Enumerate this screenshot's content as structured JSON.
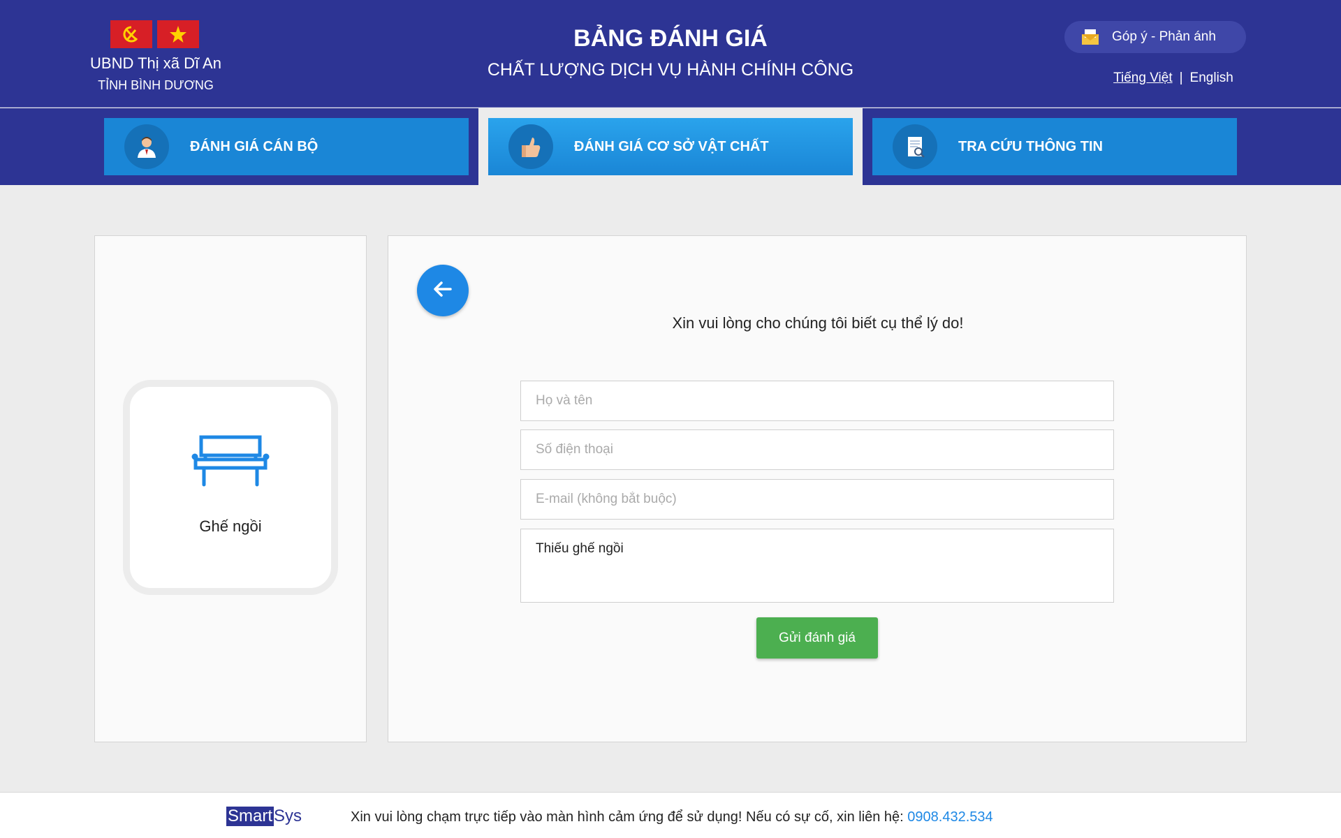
{
  "header": {
    "org_name": "UBND Thị xã Dĩ An",
    "org_province": "TỈNH BÌNH DƯƠNG",
    "title_main": "BẢNG ĐÁNH GIÁ",
    "title_sub": "CHẤT LƯỢNG DỊCH VỤ HÀNH CHÍNH CÔNG",
    "feedback_label": "Góp ý - Phản ánh",
    "lang_vi": "Tiếng Việt",
    "lang_sep": "|",
    "lang_en": "English"
  },
  "nav": {
    "tabs": [
      {
        "label": "ĐÁNH GIÁ CÁN BỘ",
        "icon": "officer-icon"
      },
      {
        "label": "ĐÁNH GIÁ CƠ SỞ VẬT CHẤT",
        "icon": "thumbs-up-icon",
        "active": true
      },
      {
        "label": "TRA CỨU THÔNG TIN",
        "icon": "document-search-icon"
      }
    ]
  },
  "item": {
    "label": "Ghế ngồi",
    "icon": "bench-icon"
  },
  "form": {
    "prompt": "Xin vui lòng cho chúng tôi biết cụ thể lý do!",
    "name_placeholder": "Họ và tên",
    "phone_placeholder": "Số điện thoại",
    "email_placeholder": "E-mail (không bắt buộc)",
    "reason_value": "Thiếu ghế ngồi",
    "submit_label": "Gửi đánh giá"
  },
  "footer": {
    "brand_smart": "Smart",
    "brand_sys": "Sys",
    "message": "Xin vui lòng chạm trực tiếp vào màn hình cảm ứng để sử dụng! Nếu có sự cố, xin liên hệ: ",
    "phone": "0908.432.534"
  },
  "colors": {
    "header_bg": "#2d3494",
    "tab_blue": "#1a86d6",
    "accent_blue": "#1e88e5",
    "submit_green": "#4caf50"
  }
}
